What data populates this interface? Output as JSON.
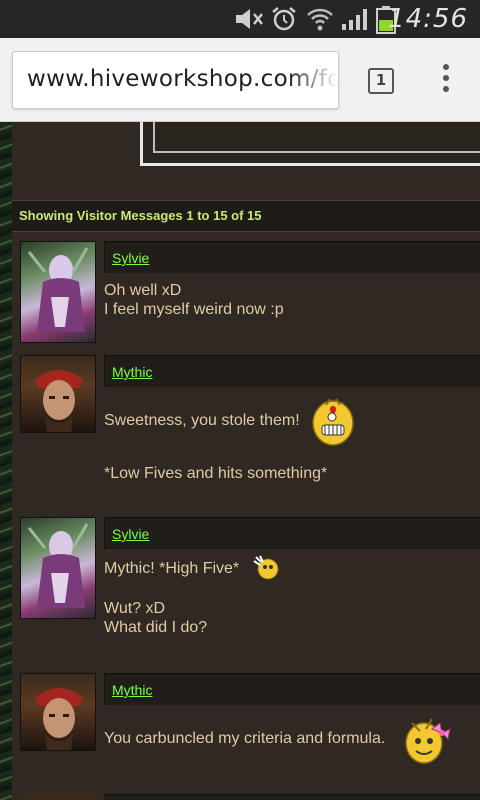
{
  "status_bar": {
    "time": "14:56",
    "icons": [
      "mute-icon",
      "alarm-icon",
      "wifi-icon",
      "signal-icon",
      "battery-icon"
    ]
  },
  "browser": {
    "url": "www.hiveworkshop.com/fo",
    "tab_count": "1",
    "menu_icon": "overflow-menu-icon"
  },
  "page": {
    "header": "Showing Visitor Messages 1 to 15 of 15",
    "messages": [
      {
        "author": "Sylvie",
        "avatar": "avatar-sylvie",
        "lines": [
          "Oh well xD",
          "I feel myself weird now :p"
        ]
      },
      {
        "author": "Mythic",
        "avatar": "avatar-mythic",
        "lines": [
          "Sweetness, you stole them!",
          "*Low Fives and hits something*"
        ],
        "smiley": "angry-smiley-icon"
      },
      {
        "author": "Sylvie",
        "avatar": "avatar-sylvie",
        "lines": [
          "Mythic! *High Five*",
          "Wut? xD",
          "What did I do?"
        ],
        "smiley": "high-five-smiley-icon"
      },
      {
        "author": "Mythic",
        "avatar": "avatar-mythic",
        "lines": [
          "You carbuncled my criteria and formula."
        ],
        "smiley": "bow-smiley-icon"
      }
    ]
  },
  "colors": {
    "page_bg": "#2f2823",
    "name_link": "#7dff3a",
    "header_text": "#c9ec6f",
    "message_text": "#e0cba4"
  }
}
